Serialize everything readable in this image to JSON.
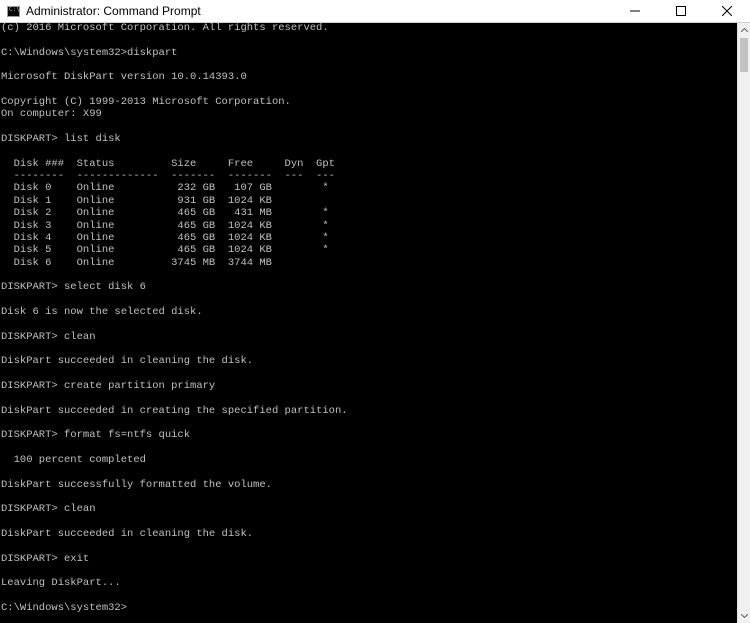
{
  "window": {
    "title": "Administrator: Command Prompt",
    "icon": "cmd-icon",
    "controls": [
      "minimize-icon",
      "maximize-icon",
      "close-icon"
    ]
  },
  "console": {
    "text_color": "#c0c0c0",
    "background": "#000000",
    "lines": [
      "(c) 2016 Microsoft Corporation. All rights reserved.",
      "",
      "C:\\Windows\\system32>diskpart",
      "",
      "Microsoft DiskPart version 10.0.14393.0",
      "",
      "Copyright (C) 1999-2013 Microsoft Corporation.",
      "On computer: X99",
      "",
      "DISKPART> list disk",
      "",
      "  Disk ###  Status         Size     Free     Dyn  Gpt",
      "  --------  -------------  -------  -------  ---  ---",
      "  Disk 0    Online          232 GB   107 GB        *",
      "  Disk 1    Online          931 GB  1024 KB",
      "  Disk 2    Online          465 GB   431 MB        *",
      "  Disk 3    Online          465 GB  1024 KB        *",
      "  Disk 4    Online          465 GB  1024 KB        *",
      "  Disk 5    Online          465 GB  1024 KB        *",
      "  Disk 6    Online         3745 MB  3744 MB",
      "",
      "DISKPART> select disk 6",
      "",
      "Disk 6 is now the selected disk.",
      "",
      "DISKPART> clean",
      "",
      "DiskPart succeeded in cleaning the disk.",
      "",
      "DISKPART> create partition primary",
      "",
      "DiskPart succeeded in creating the specified partition.",
      "",
      "DISKPART> format fs=ntfs quick",
      "",
      "  100 percent completed",
      "",
      "DiskPart successfully formatted the volume.",
      "",
      "DISKPART> clean",
      "",
      "DiskPart succeeded in cleaning the disk.",
      "",
      "DISKPART> exit",
      "",
      "Leaving DiskPart...",
      "",
      "C:\\Windows\\system32>"
    ]
  }
}
